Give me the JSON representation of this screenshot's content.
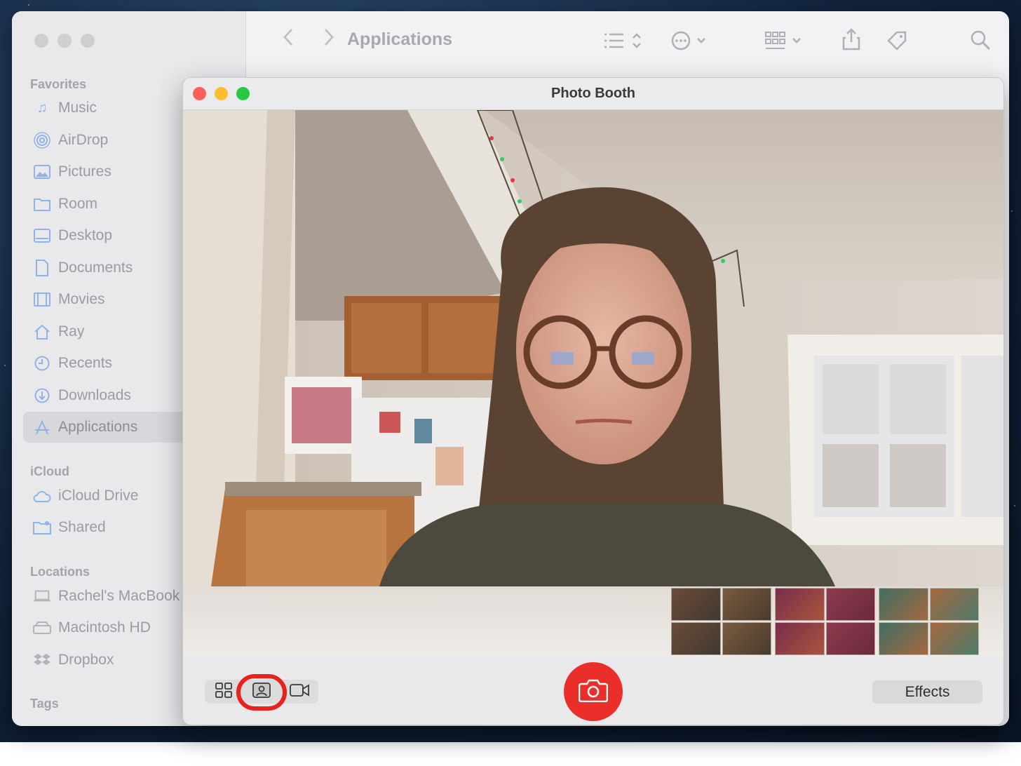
{
  "finder": {
    "title": "Applications",
    "sidebar": {
      "favorites_label": "Favorites",
      "favorites": [
        {
          "label": "Music",
          "icon": "music-icon"
        },
        {
          "label": "AirDrop",
          "icon": "airdrop-icon"
        },
        {
          "label": "Pictures",
          "icon": "pictures-icon"
        },
        {
          "label": "Room",
          "icon": "folder-icon"
        },
        {
          "label": "Desktop",
          "icon": "desktop-icon"
        },
        {
          "label": "Documents",
          "icon": "document-icon"
        },
        {
          "label": "Movies",
          "icon": "film-icon"
        },
        {
          "label": "Ray",
          "icon": "home-icon"
        },
        {
          "label": "Recents",
          "icon": "clock-icon"
        },
        {
          "label": "Downloads",
          "icon": "download-icon"
        },
        {
          "label": "Applications",
          "icon": "applications-icon",
          "active": true
        }
      ],
      "icloud_label": "iCloud",
      "icloud": [
        {
          "label": "iCloud Drive",
          "icon": "cloud-icon"
        },
        {
          "label": "Shared",
          "icon": "shared-folder-icon"
        }
      ],
      "locations_label": "Locations",
      "locations": [
        {
          "label": "Rachel's MacBook",
          "icon": "laptop-icon"
        },
        {
          "label": "Macintosh HD",
          "icon": "disk-icon"
        },
        {
          "label": "Dropbox",
          "icon": "dropbox-icon"
        }
      ],
      "tags_label": "Tags"
    }
  },
  "photobooth": {
    "title": "Photo Booth",
    "effects_label": "Effects",
    "modes": [
      "four-up-grid",
      "single-photo",
      "video"
    ],
    "selected_mode": "single-photo",
    "colors": {
      "shutter": "#ea2e29",
      "highlight_ring": "#e8221c",
      "close": "#fe5f57",
      "minimize": "#febc2e",
      "zoom": "#28c840"
    }
  }
}
